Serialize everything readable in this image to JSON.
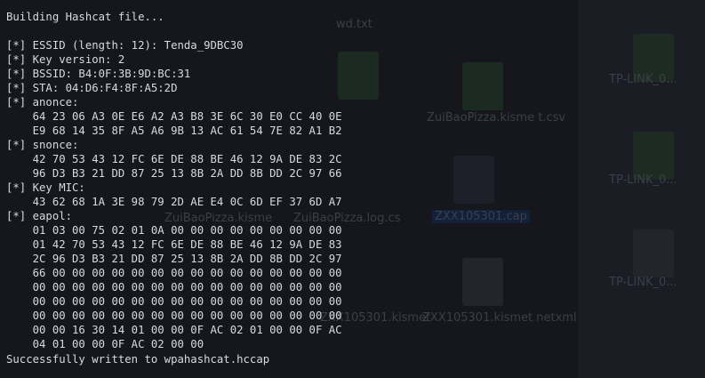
{
  "terminal": {
    "header": "Building Hashcat file...",
    "fields": [
      {
        "prefix": "[*]",
        "text": "ESSID (length: 12): Tenda_9DBC30"
      },
      {
        "prefix": "[*]",
        "text": "Key version: 2"
      },
      {
        "prefix": "[*]",
        "text": "BSSID: B4:0F:3B:9D:BC:31"
      },
      {
        "prefix": "[*]",
        "text": "STA: 04:D6:F4:8F:A5:2D"
      },
      {
        "prefix": "[*]",
        "text": "anonce:"
      },
      {
        "indent": true,
        "text": "64 23 06 A3 0E E6 A2 A3 B8 3E 6C 30 E0 CC 40 0E"
      },
      {
        "indent": true,
        "text": "E9 68 14 35 8F A5 A6 9B 13 AC 61 54 7E 82 A1 B2"
      },
      {
        "prefix": "[*]",
        "text": "snonce:"
      },
      {
        "indent": true,
        "text": "42 70 53 43 12 FC 6E DE 88 BE 46 12 9A DE 83 2C"
      },
      {
        "indent": true,
        "text": "96 D3 B3 21 DD 87 25 13 8B 2A DD 8B DD 2C 97 66"
      },
      {
        "prefix": "[*]",
        "text": "Key MIC:"
      },
      {
        "indent": true,
        "text": "43 62 68 1A 3E 98 79 2D AE E4 0C 6D EF 37 6D A7"
      },
      {
        "prefix": "[*]",
        "text": "eapol:"
      },
      {
        "indent": true,
        "text": "01 03 00 75 02 01 0A 00 00 00 00 00 00 00 00 00"
      },
      {
        "indent": true,
        "text": "01 42 70 53 43 12 FC 6E DE 88 BE 46 12 9A DE 83"
      },
      {
        "indent": true,
        "text": "2C 96 D3 B3 21 DD 87 25 13 8B 2A DD 8B DD 2C 97"
      },
      {
        "indent": true,
        "text": "66 00 00 00 00 00 00 00 00 00 00 00 00 00 00 00"
      },
      {
        "indent": true,
        "text": "00 00 00 00 00 00 00 00 00 00 00 00 00 00 00 00"
      },
      {
        "indent": true,
        "text": "00 00 00 00 00 00 00 00 00 00 00 00 00 00 00 00"
      },
      {
        "indent": true,
        "text": "00 00 00 00 00 00 00 00 00 00 00 00 00 00 00 00"
      },
      {
        "indent": true,
        "text": "00 00 16 30 14 01 00 00 0F AC 02 01 00 00 0F AC"
      },
      {
        "indent": true,
        "text": "04 01 00 00 0F AC 02 00 00"
      }
    ],
    "footer": "Successfully written to wpahashcat.hccap"
  },
  "background_desktop": {
    "labels": [
      "wd.txt",
      "TP-LINK_0...",
      "ZuiBaoPizza.kisme t.csv",
      "TP-LINK_0...",
      "ZuiBaoPizza.kisme",
      "ZuiBaoPizza.log.cs",
      "ZXX105301.cap",
      "TP-LINK_0...",
      "ZXX105301.kismet",
      "ZXX105301.kismet netxml"
    ]
  },
  "colors": {
    "terminal_text": "#d8dade",
    "terminal_bg": "#15171c"
  }
}
